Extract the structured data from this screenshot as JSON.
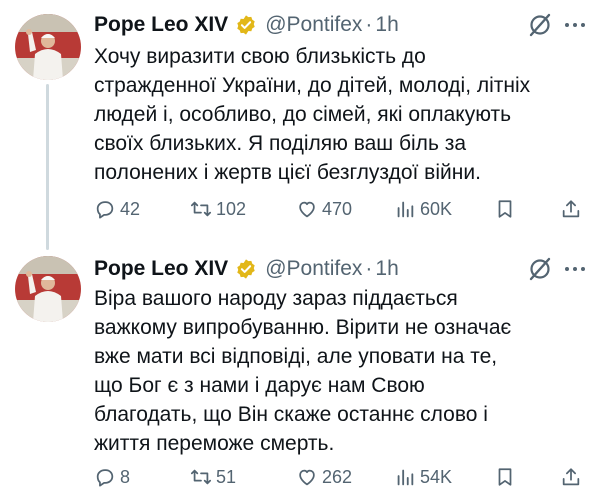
{
  "tweets": [
    {
      "author_name": "Pope Leo XIV",
      "handle": "@Pontifex",
      "separator": "·",
      "time": "1h",
      "text_lines": [
        "Хочу виразити свою близькість до",
        "стражденної України, до дітей, молоді, літніх",
        "людей і, особливо, до сімей, які оплакують",
        "своїх близьких. Я поділяю ваш біль за",
        "полонених і жертв цієї безглуздої війни."
      ],
      "stats": {
        "replies": "42",
        "reposts": "102",
        "likes": "470",
        "views": "60K"
      }
    },
    {
      "author_name": "Pope Leo XIV",
      "handle": "@Pontifex",
      "separator": "·",
      "time": "1h",
      "text_lines": [
        "Віра вашого народу зараз піддається",
        "важкому випробуванню. Вірити не означає",
        "вже мати всі відповіді, але уповати на те,",
        "що Бог є з нами і дарує нам Свою",
        "благодать, що Він скаже останнє слово і",
        "життя переможе смерть."
      ],
      "stats": {
        "replies": "8",
        "reposts": "51",
        "likes": "262",
        "views": "54K"
      }
    }
  ],
  "icons": {
    "verified": "verified-badge-icon",
    "grok": "grok-icon",
    "more": "more-icon",
    "reply": "reply-icon",
    "repost": "repost-icon",
    "like": "like-icon",
    "views": "views-icon",
    "bookmark": "bookmark-icon",
    "share": "share-icon"
  },
  "colors": {
    "text": "#0f1419",
    "secondary": "#536471",
    "verified_gold": "#e2b719",
    "thread_line": "#cfd9de"
  }
}
